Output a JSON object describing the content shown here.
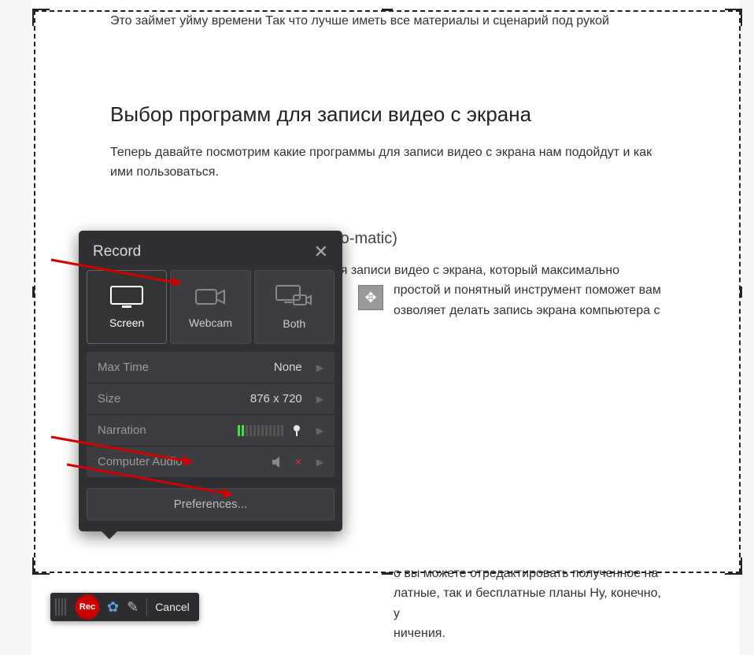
{
  "article": {
    "intro_cutoff": "Это займет уйму времени  Так  что лучше иметь все материалы и сценарий под рукой",
    "h2": "Выбор программ для записи видео с экрана",
    "p1": "Теперь давайте посмотрим какие программы для записи видео с экрана нам подойдут и как ими пользоваться.",
    "h3": "Скринкаст-о-метик (Screencast-o-matic)",
    "p2a": "Screencast-O-Matic - это инструмент для записи видео с экрана, который максимально",
    "p2b": "простой и понятный инструмент поможет вам",
    "p2c": "озволяет делать запись экрана компьютера с",
    "p3a": "о вы можете отредактировать полученное на",
    "p3b": "латные, так и бесплатные планы Ну, конечно, у",
    "p3c": "ничения."
  },
  "panel": {
    "title": "Record",
    "modes": {
      "screen": "Screen",
      "webcam": "Webcam",
      "both": "Both"
    },
    "rows": {
      "maxtime_label": "Max Time",
      "maxtime_value": "None",
      "size_label": "Size",
      "size_value": "876 x 720",
      "narration_label": "Narration",
      "compaudio_label": "Computer Audio"
    },
    "prefs": "Preferences...",
    "narration_level": 2,
    "narration_total": 12,
    "compaudio_muted": true
  },
  "toolbar": {
    "rec": "Rec",
    "cancel": "Cancel"
  },
  "capture": {
    "size_w": 876,
    "size_h": 720
  },
  "move_glyph": "✥"
}
